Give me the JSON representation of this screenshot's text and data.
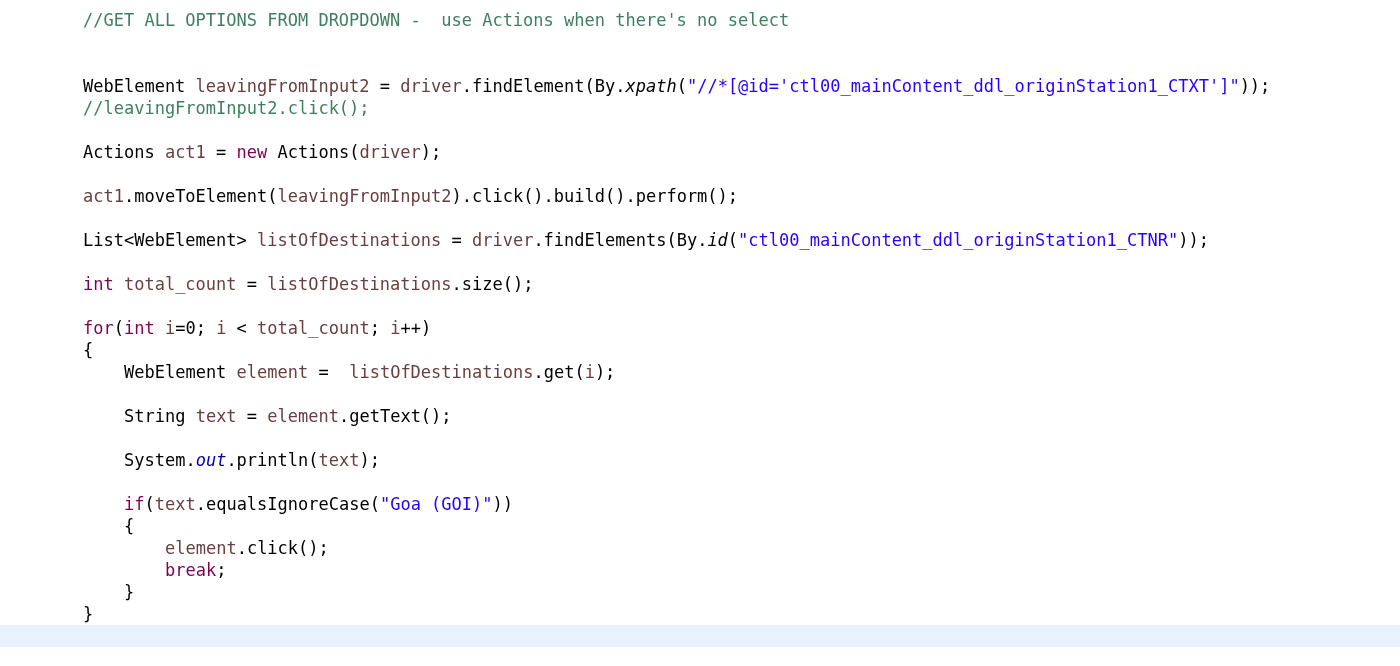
{
  "editor": {
    "lines": [
      {
        "kind": "code",
        "tokens": [
          {
            "text": "//GET ALL OPTIONS FROM DROPDOWN -  use Actions when there's no select",
            "kind": "comment"
          }
        ]
      },
      {
        "kind": "blank"
      },
      {
        "kind": "blank"
      },
      {
        "kind": "code",
        "tokens": [
          {
            "text": "WebElement ",
            "kind": "plain"
          },
          {
            "text": "leavingFromInput2",
            "kind": "var"
          },
          {
            "text": " = ",
            "kind": "plain"
          },
          {
            "text": "driver",
            "kind": "var"
          },
          {
            "text": ".findElement(By.",
            "kind": "plain"
          },
          {
            "text": "xpath",
            "kind": "static"
          },
          {
            "text": "(",
            "kind": "plain"
          },
          {
            "text": "\"//*[@id='ctl00_mainContent_ddl_originStation1_CTXT']\"",
            "kind": "string"
          },
          {
            "text": "));",
            "kind": "plain"
          }
        ]
      },
      {
        "kind": "code",
        "tokens": [
          {
            "text": "//leavingFromInput2.click();",
            "kind": "comment"
          }
        ]
      },
      {
        "kind": "blank"
      },
      {
        "kind": "code",
        "tokens": [
          {
            "text": "Actions ",
            "kind": "plain"
          },
          {
            "text": "act1",
            "kind": "var"
          },
          {
            "text": " = ",
            "kind": "plain"
          },
          {
            "text": "new",
            "kind": "keyword"
          },
          {
            "text": " Actions(",
            "kind": "plain"
          },
          {
            "text": "driver",
            "kind": "var"
          },
          {
            "text": ");",
            "kind": "plain"
          }
        ]
      },
      {
        "kind": "blank"
      },
      {
        "kind": "code",
        "tokens": [
          {
            "text": "act1",
            "kind": "var"
          },
          {
            "text": ".moveToElement(",
            "kind": "plain"
          },
          {
            "text": "leavingFromInput2",
            "kind": "var"
          },
          {
            "text": ").click().build().perform();",
            "kind": "plain"
          }
        ]
      },
      {
        "kind": "blank"
      },
      {
        "kind": "code",
        "tokens": [
          {
            "text": "List<WebElement> ",
            "kind": "plain"
          },
          {
            "text": "listOfDestinations",
            "kind": "var"
          },
          {
            "text": " = ",
            "kind": "plain"
          },
          {
            "text": "driver",
            "kind": "var"
          },
          {
            "text": ".findElements(By.",
            "kind": "plain"
          },
          {
            "text": "id",
            "kind": "static"
          },
          {
            "text": "(",
            "kind": "plain"
          },
          {
            "text": "\"ctl00_mainContent_ddl_originStation1_CTNR\"",
            "kind": "string"
          },
          {
            "text": "));",
            "kind": "plain"
          }
        ]
      },
      {
        "kind": "blank"
      },
      {
        "kind": "code",
        "tokens": [
          {
            "text": "int ",
            "kind": "keyword"
          },
          {
            "text": "total_count",
            "kind": "var"
          },
          {
            "text": " = ",
            "kind": "plain"
          },
          {
            "text": "listOfDestinations",
            "kind": "var"
          },
          {
            "text": ".size();",
            "kind": "plain"
          }
        ]
      },
      {
        "kind": "blank"
      },
      {
        "kind": "code",
        "tokens": [
          {
            "text": "for",
            "kind": "keyword"
          },
          {
            "text": "(",
            "kind": "plain"
          },
          {
            "text": "int ",
            "kind": "keyword"
          },
          {
            "text": "i",
            "kind": "var"
          },
          {
            "text": "=0; ",
            "kind": "plain"
          },
          {
            "text": "i",
            "kind": "var"
          },
          {
            "text": " < ",
            "kind": "plain"
          },
          {
            "text": "total_count",
            "kind": "var"
          },
          {
            "text": "; ",
            "kind": "plain"
          },
          {
            "text": "i",
            "kind": "var"
          },
          {
            "text": "++)",
            "kind": "plain"
          }
        ]
      },
      {
        "kind": "code",
        "tokens": [
          {
            "text": "{",
            "kind": "plain"
          }
        ]
      },
      {
        "kind": "block",
        "children": [
          {
            "kind": "code",
            "tokens": [
              {
                "text": "WebElement ",
                "kind": "plain"
              },
              {
                "text": "element",
                "kind": "var"
              },
              {
                "text": " =  ",
                "kind": "plain"
              },
              {
                "text": "listOfDestinations",
                "kind": "var"
              },
              {
                "text": ".get(",
                "kind": "plain"
              },
              {
                "text": "i",
                "kind": "var"
              },
              {
                "text": ");",
                "kind": "plain"
              }
            ]
          },
          {
            "kind": "blank"
          },
          {
            "kind": "code",
            "tokens": [
              {
                "text": "String ",
                "kind": "plain"
              },
              {
                "text": "text",
                "kind": "var"
              },
              {
                "text": " = ",
                "kind": "plain"
              },
              {
                "text": "element",
                "kind": "var"
              },
              {
                "text": ".getText();",
                "kind": "plain"
              }
            ]
          },
          {
            "kind": "blank"
          },
          {
            "kind": "code",
            "tokens": [
              {
                "text": "System.",
                "kind": "plain"
              },
              {
                "text": "out",
                "kind": "field"
              },
              {
                "text": ".println(",
                "kind": "plain"
              },
              {
                "text": "text",
                "kind": "var"
              },
              {
                "text": ");",
                "kind": "plain"
              }
            ]
          },
          {
            "kind": "blank"
          },
          {
            "kind": "code",
            "tokens": [
              {
                "text": "if",
                "kind": "keyword"
              },
              {
                "text": "(",
                "kind": "plain"
              },
              {
                "text": "text",
                "kind": "var"
              },
              {
                "text": ".equalsIgnoreCase(",
                "kind": "plain"
              },
              {
                "text": "\"Goa (GOI)\"",
                "kind": "string"
              },
              {
                "text": "))",
                "kind": "plain"
              }
            ]
          },
          {
            "kind": "code",
            "tokens": [
              {
                "text": "{",
                "kind": "plain"
              }
            ]
          },
          {
            "kind": "block",
            "children": [
              {
                "kind": "code",
                "tokens": [
                  {
                    "text": "element",
                    "kind": "var"
                  },
                  {
                    "text": ".click();",
                    "kind": "plain"
                  }
                ]
              },
              {
                "kind": "code",
                "tokens": [
                  {
                    "text": "break",
                    "kind": "keyword"
                  },
                  {
                    "text": ";",
                    "kind": "plain"
                  }
                ]
              }
            ]
          },
          {
            "kind": "code",
            "tokens": [
              {
                "text": "}",
                "kind": "plain"
              }
            ]
          }
        ]
      },
      {
        "kind": "code",
        "tokens": [
          {
            "text": "}",
            "kind": "plain"
          }
        ]
      },
      {
        "kind": "cursor-line"
      }
    ]
  }
}
